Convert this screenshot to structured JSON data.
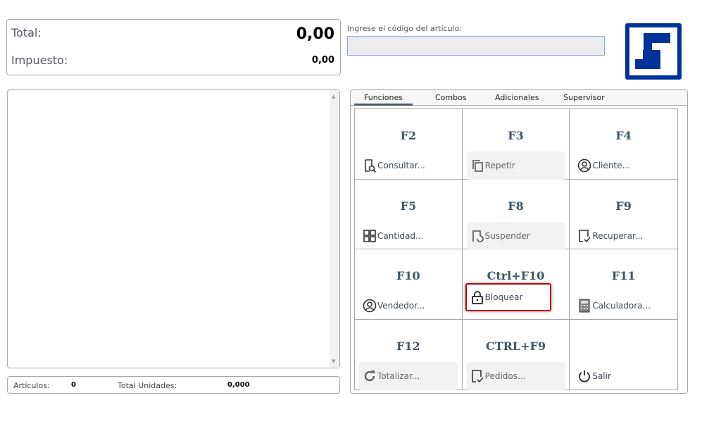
{
  "totals": {
    "total_label": "Total:",
    "total_value": "0,00",
    "tax_label": "Impuesto:",
    "tax_value": "0,00"
  },
  "code": {
    "label": "Ingrese el código del artículo:",
    "value": ""
  },
  "status": {
    "articles_label": "Artículos:",
    "articles_value": "0",
    "units_label": "Total Unidades:",
    "units_value": "0,000"
  },
  "tabs": [
    "Funciones",
    "Combos",
    "Adicionales",
    "Supervisor"
  ],
  "functions": [
    {
      "key": "F2",
      "label": "Consultar...",
      "icon": "search-doc-icon",
      "disabled": false
    },
    {
      "key": "F3",
      "label": "Repetir",
      "icon": "copy-icon",
      "disabled": true
    },
    {
      "key": "F4",
      "label": "Cliente...",
      "icon": "user-icon",
      "disabled": false
    },
    {
      "key": "F5",
      "label": "Cantidad...",
      "icon": "grid-icon",
      "disabled": false
    },
    {
      "key": "F8",
      "label": "Suspender",
      "icon": "suspend-icon",
      "disabled": true
    },
    {
      "key": "F9",
      "label": "Recuperar...",
      "icon": "doc-check-icon",
      "disabled": false
    },
    {
      "key": "F10",
      "label": "Vendedor...",
      "icon": "user-icon",
      "disabled": false
    },
    {
      "key": "Ctrl+F10",
      "label": "Bloquear",
      "icon": "lock-icon",
      "disabled": false
    },
    {
      "key": "F11",
      "label": "Calculadora...",
      "icon": "calculator-icon",
      "disabled": false
    },
    {
      "key": "F12",
      "label": "Totalizar...",
      "icon": "refresh-icon",
      "disabled": true
    },
    {
      "key": "CTRL+F9",
      "label": "Pedidos...",
      "icon": "doc-check-icon",
      "disabled": true
    },
    {
      "key": "",
      "label": "Salir",
      "icon": "power-icon",
      "disabled": false
    }
  ]
}
